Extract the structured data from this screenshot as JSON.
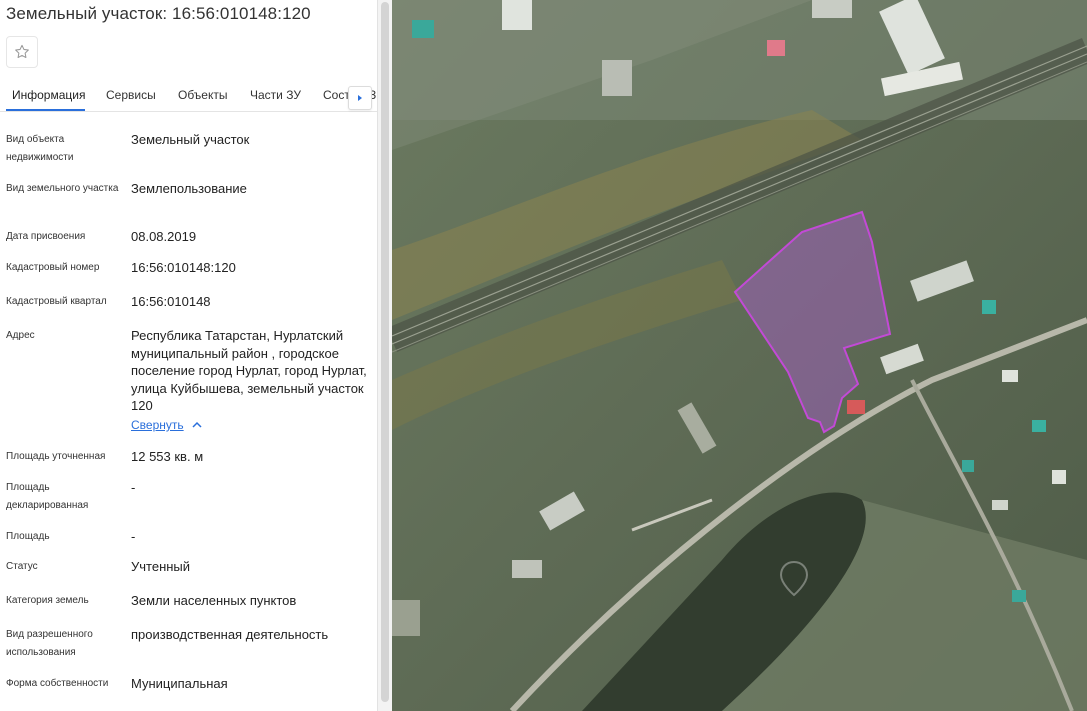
{
  "header": {
    "title": "Земельный участок: 16:56:010148:120"
  },
  "tabs": [
    {
      "label": "Информация",
      "active": true
    },
    {
      "label": "Сервисы"
    },
    {
      "label": "Объекты"
    },
    {
      "label": "Части ЗУ"
    },
    {
      "label": "Сост"
    },
    {
      "label": "З"
    }
  ],
  "icons": {
    "favorite": "star-icon",
    "tabs_scroll": "chevron-right-icon",
    "collapse": "chevron-up-icon"
  },
  "colors": {
    "accent": "#2a6fdb",
    "parcel_outline": "#c24ad6",
    "parcel_fill": "#b05ed6"
  },
  "props": [
    {
      "label": "Вид объекта недвижимости",
      "value": "Земельный участок"
    },
    {
      "label": "Вид земельного участка",
      "value": "Землепользование"
    },
    {
      "label": "Дата присвоения",
      "value": "08.08.2019"
    },
    {
      "label": "Кадастровый номер",
      "value": "16:56:010148:120"
    },
    {
      "label": "Кадастровый квартал",
      "value": "16:56:010148"
    },
    {
      "label": "Адрес",
      "value": "Республика Татарстан, Нурлатский муниципальный район , городское поселение город Нурлат, город Нурлат, улица Куйбышева, земельный участок 120",
      "link": "Свернуть"
    },
    {
      "label": "Площадь уточненная",
      "value": "12 553 кв. м"
    },
    {
      "label": "Площадь декларированная",
      "value": "-"
    },
    {
      "label": "Площадь",
      "value": "-"
    },
    {
      "label": "Статус",
      "value": "Учтенный"
    },
    {
      "label": "Категория земель",
      "value": "Земли населенных пунктов"
    },
    {
      "label": "Вид разрешенного использования",
      "value": "производственная деятельность"
    },
    {
      "label": "Форма собственности",
      "value": "Муниципальная"
    }
  ]
}
